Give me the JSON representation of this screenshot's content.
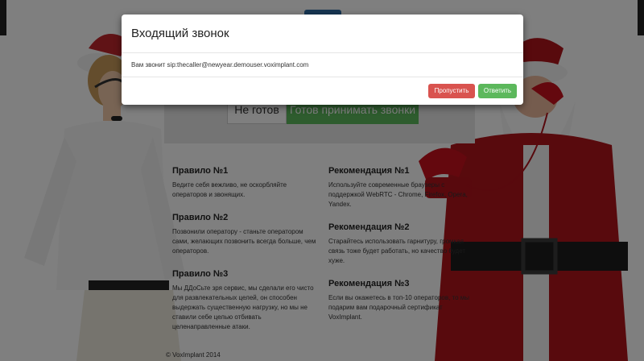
{
  "page": {
    "status_buttons": {
      "not_ready": "Не готов",
      "ready": "Готов принимать звонки"
    },
    "rules": [
      {
        "title": "Правило №1",
        "text": "Ведите себя вежливо, не оскорбляйте операторов и звонящих."
      },
      {
        "title": "Правило №2",
        "text": "Позвонили оператору - станьте оператором сами, желающих позвонить всегда больше, чем операторов."
      },
      {
        "title": "Правило №3",
        "text": "Мы ДДоСьте зря сервис, мы сделали его чисто для развлекательных целей, он способен выдержать существенную нагрузку, но мы не ставили себе целью отбивать целенаправленные атаки."
      }
    ],
    "recommendations": [
      {
        "title": "Рекомендация №1",
        "text": "Используйте современные браузеры с поддержкой WebRTC - Chrome, Firefox, Opera, Yandex."
      },
      {
        "title": "Рекомендация №2",
        "text": "Старайтесь использовать гарнитуру, громкая связь тоже будет работать, но качество будет хуже."
      },
      {
        "title": "Рекомендация №3",
        "text": "Если вы окажетесь в топ-10 операторов, то мы подарим вам подарочный сертификат VoxImplant."
      }
    ],
    "footer": "© VoxImplant 2014"
  },
  "modal": {
    "title": "Входящий звонок",
    "message": "Вам звонит sip:thecaller@newyear.demouser.voximplant.com",
    "skip_label": "Пропустить",
    "answer_label": "Ответить"
  },
  "colors": {
    "accent_green": "#5cb85c",
    "danger_red": "#d9534f",
    "overlay": "rgba(0,0,0,0.5)"
  }
}
